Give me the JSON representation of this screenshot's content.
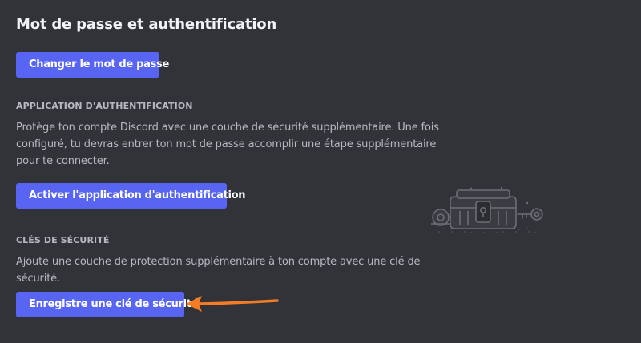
{
  "page": {
    "title": "Mot de passe et authentification"
  },
  "password": {
    "change_button": "Changer le mot de passe"
  },
  "auth_app": {
    "heading": "APPLICATION D'AUTHENTIFICATION",
    "description_lines": [
      "Protège ton compte Discord avec une couche de sécurité supplémentaire. Une fois",
      "configuré, tu devras entrer ton mot de passe accomplir une étape supplémentaire",
      "pour te connecter."
    ],
    "enable_button": "Activer l'application d'authentification",
    "illustration_icon": "vault-key-illustration"
  },
  "security_keys": {
    "heading": "CLÉS DE SÉCURITÉ",
    "description_lines": [
      "Ajoute une couche de protection supplémentaire à ton compte avec une clé de",
      "sécurité."
    ],
    "register_button": "Enregistre une clé de sécurité"
  },
  "annotation": {
    "arrow_icon": "arrow-left-icon",
    "arrow_color": "#f57c22"
  },
  "colors": {
    "background": "#313338",
    "button": "#5865f2",
    "title_text": "#f2f3f5",
    "body_text": "#b5bac1"
  }
}
